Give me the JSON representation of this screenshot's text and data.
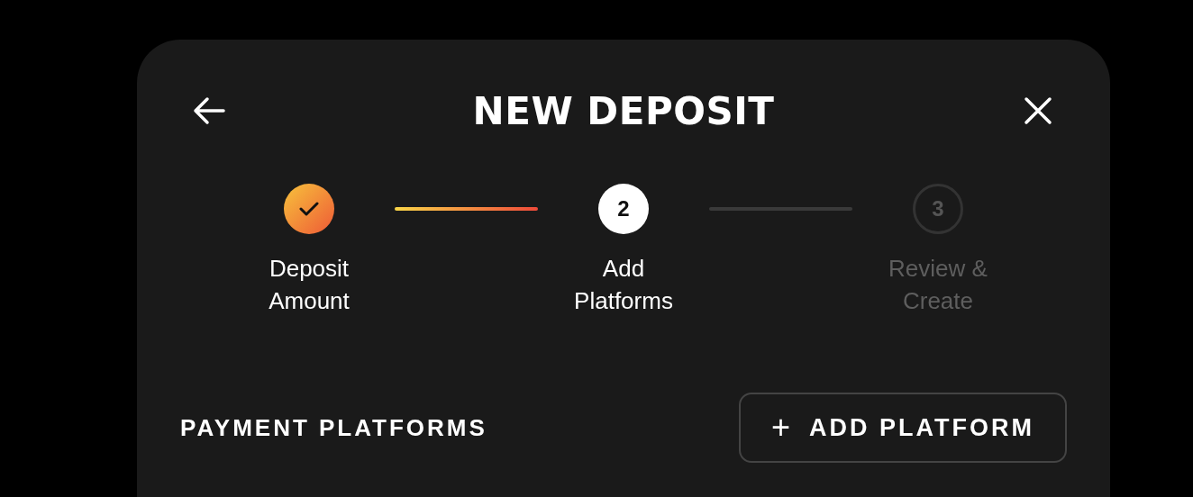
{
  "dialog": {
    "title": "NEW DEPOSIT"
  },
  "steps": [
    {
      "label": "Deposit Amount",
      "completed": true,
      "selected": false
    },
    {
      "label": "Add Platforms",
      "completed": false,
      "selected": true,
      "number": "2"
    },
    {
      "label": "Review & Create",
      "completed": false,
      "selected": false,
      "number": "3"
    }
  ],
  "connectors": [
    {
      "completed": true
    },
    {
      "completed": false
    }
  ],
  "section": {
    "title": "PAYMENT PLATFORMS",
    "button": {
      "icon": "+",
      "label": "ADD PLATFORM"
    }
  }
}
